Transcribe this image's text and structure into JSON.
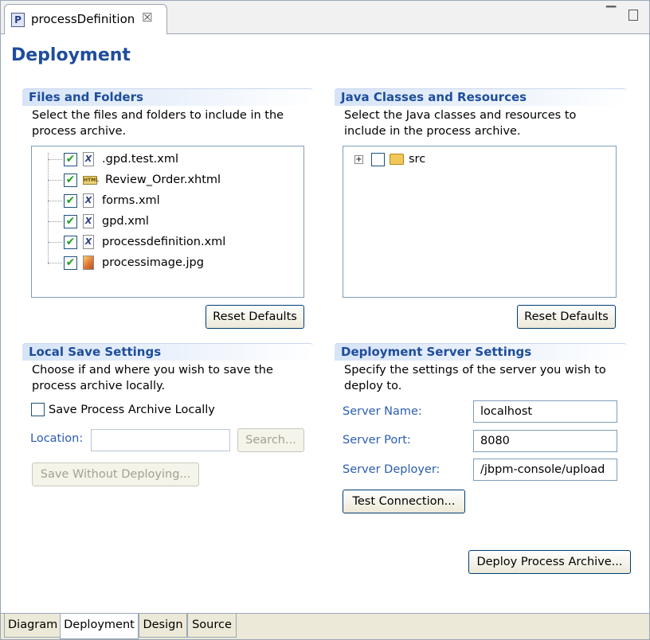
{
  "tab": {
    "icon": "P",
    "title": "processDefinition",
    "close_glyph": "☒",
    "minimize_glyph": "▭",
    "maximize": ""
  },
  "page_title": "Deployment",
  "files": {
    "title": "Files and Folders",
    "description": "Select the files and folders to include in the process archive.",
    "items": [
      {
        "name": ".gpd.test.xml",
        "icon": "xml-file-icon",
        "checked": true
      },
      {
        "name": "Review_Order.xhtml",
        "icon": "html-file-icon",
        "checked": true
      },
      {
        "name": "forms.xml",
        "icon": "xml-file-icon",
        "checked": true
      },
      {
        "name": "gpd.xml",
        "icon": "xml-file-icon",
        "checked": true
      },
      {
        "name": "processdefinition.xml",
        "icon": "xml-file-icon",
        "checked": true
      },
      {
        "name": "processimage.jpg",
        "icon": "image-file-icon",
        "checked": true
      }
    ],
    "reset_label": "Reset Defaults"
  },
  "classes": {
    "title": "Java Classes and Resources",
    "description": "Select the Java classes and resources to include in the process archive.",
    "items": [
      {
        "name": "src",
        "icon": "folder-icon",
        "checked": false
      }
    ],
    "reset_label": "Reset Defaults"
  },
  "local": {
    "title": "Local Save Settings",
    "description": "Choose if and where you wish to save the process archive locally.",
    "checkbox_label": "Save Process Archive Locally",
    "location_label": "Location:",
    "location_value": "",
    "search_label": "Search...",
    "save_label": "Save Without Deploying..."
  },
  "server": {
    "title": "Deployment Server Settings",
    "description": "Specify the settings of the server you wish to deploy to.",
    "name_label": "Server Name:",
    "name_value": "localhost",
    "port_label": "Server Port:",
    "port_value": "8080",
    "deployer_label": "Server Deployer:",
    "deployer_value": "/jbpm-console/upload",
    "test_label": "Test Connection...",
    "deploy_label": "Deploy Process Archive..."
  },
  "bottom_tabs": [
    {
      "label": "Diagram",
      "active": false
    },
    {
      "label": "Deployment",
      "active": true
    },
    {
      "label": "Design",
      "active": false
    },
    {
      "label": "Source",
      "active": false
    }
  ],
  "colors": {
    "section_title": "#1e4d9b",
    "label_blue": "#2a5db0",
    "check_green": "#21a121"
  }
}
